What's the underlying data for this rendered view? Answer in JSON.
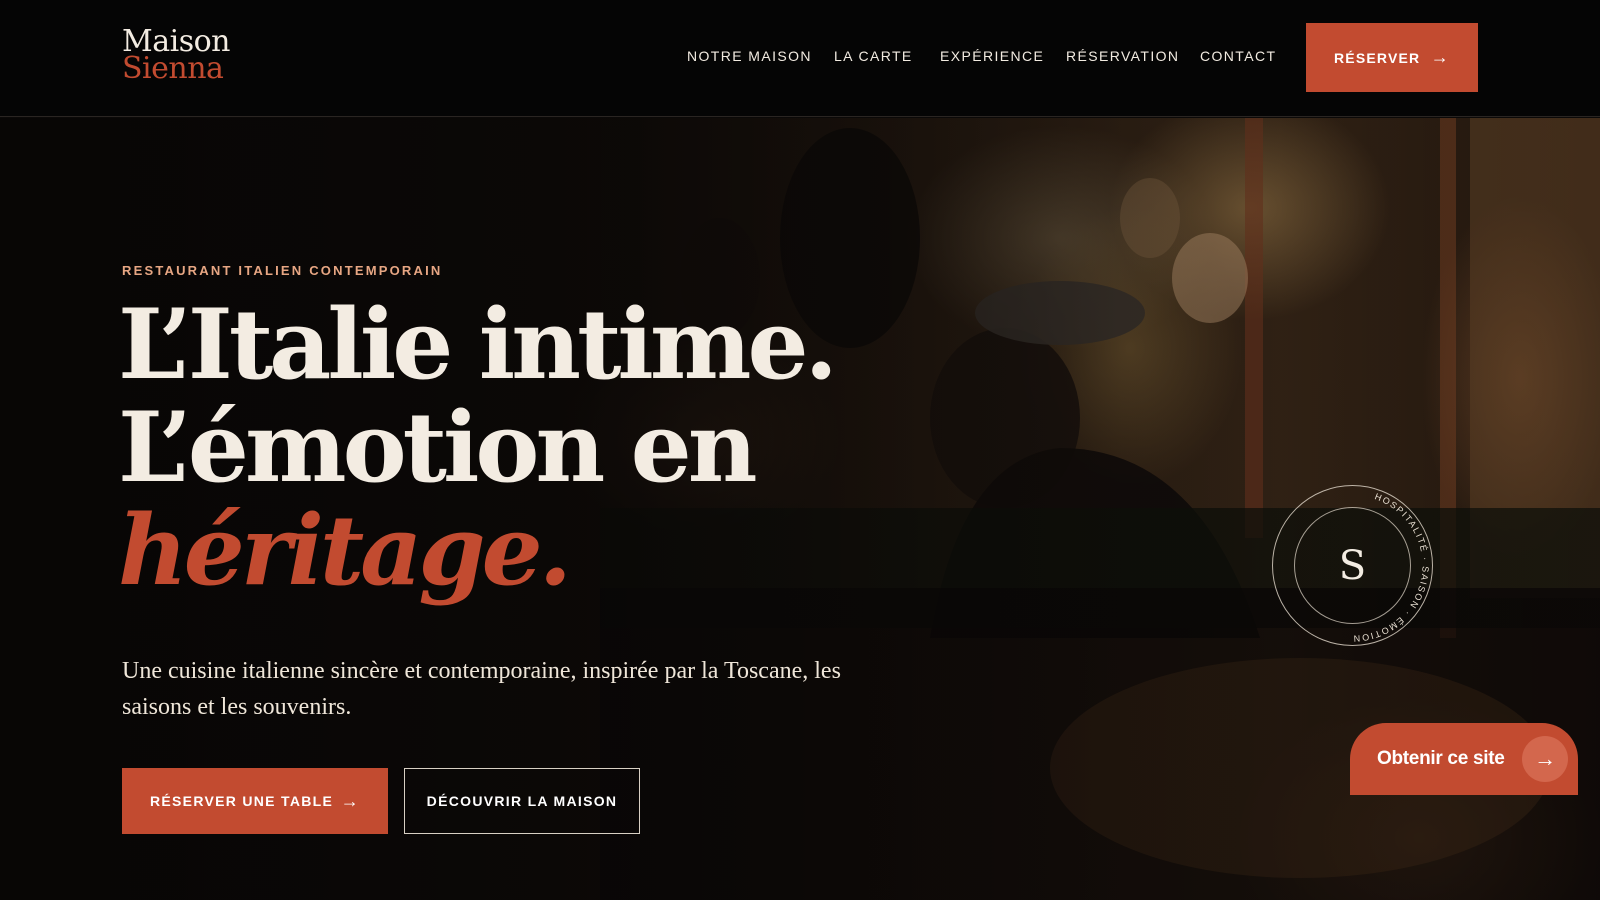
{
  "brand": {
    "line1": "Maison",
    "line2": "Sienna"
  },
  "nav": {
    "items": [
      {
        "label": "NOTRE MAISON"
      },
      {
        "label": "LA CARTE"
      },
      {
        "label": "EXPÉRIENCE"
      },
      {
        "label": "RÉSERVATION"
      },
      {
        "label": "CONTACT"
      }
    ],
    "cta_label": "RÉSERVER",
    "cta_icon": "arrow-right-icon"
  },
  "hero": {
    "eyebrow": "RESTAURANT ITALIEN CONTEMPORAIN",
    "headline_line1": "L’Italie intime.",
    "headline_line2": "L’émotion en",
    "headline_accent": "héritage.",
    "lede": "Une cuisine italienne sincère et contemporaine, inspirée par la Toscane, les saisons et les souvenirs.",
    "primary_button": "RÉSERVER UNE TABLE",
    "secondary_button": "DÉCOUVRIR LA MAISON"
  },
  "seal": {
    "letter": "S",
    "ring_text": "HOSPITALITÉ · SAISON · ÉMOTION"
  },
  "badge": {
    "label": "Obtenir ce site",
    "icon": "arrow-right-icon"
  },
  "colors": {
    "accent": "#c24b30",
    "cream": "#f3ece2",
    "eyebrow": "#e7a683",
    "header_bg": "#050505"
  }
}
